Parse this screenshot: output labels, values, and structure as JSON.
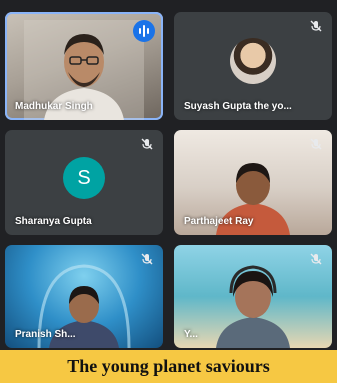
{
  "participants": [
    {
      "name": "Madhukar Singh",
      "status": "speaking"
    },
    {
      "name": "Suyash Gupta the yo...",
      "status": "muted"
    },
    {
      "name": "Sharanya Gupta",
      "avatar_letter": "S",
      "status": "muted"
    },
    {
      "name": "Parthajeet Ray",
      "status": "muted"
    },
    {
      "name": "Pranish Sh...",
      "status": "muted"
    },
    {
      "name": "Y...",
      "status": "muted"
    }
  ],
  "caption": "The young planet saviours",
  "colors": {
    "caption_bg": "#f6c843",
    "grid_bg": "#202124",
    "avatar_tile_bg": "#3c4043",
    "letter_avatar_bg": "#00a3a3",
    "speaking_indicator": "#1a73e8",
    "active_border": "#8ab4f8"
  },
  "icons": {
    "muted": "mic-off-icon",
    "speaking": "audio-wave-icon"
  }
}
